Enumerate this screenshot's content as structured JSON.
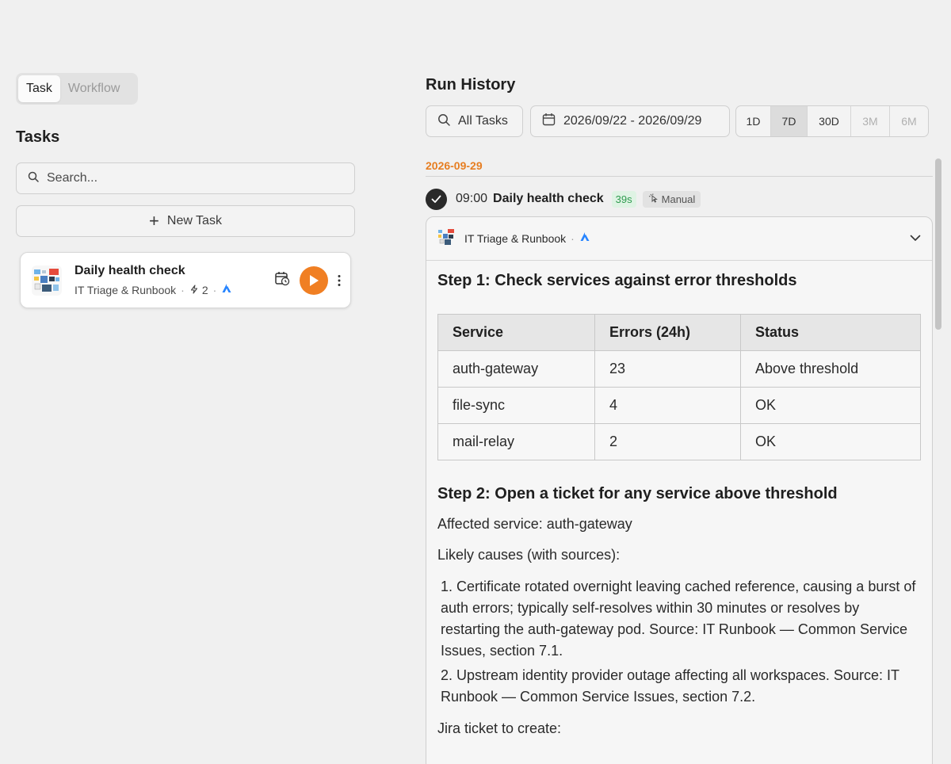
{
  "mode_toggle": {
    "task_label": "Task",
    "workflow_label": "Workflow"
  },
  "tasks_panel": {
    "title": "Tasks",
    "search_placeholder": "Search...",
    "new_task_label": "New Task",
    "items": [
      {
        "name": "Daily health check",
        "agent": "IT Triage & Runbook",
        "steps": "2"
      }
    ]
  },
  "run_history": {
    "title": "Run History",
    "filter_label": "All Tasks",
    "date_range": "2026/09/22 - 2026/09/29",
    "ranges": [
      {
        "label": "1D",
        "state": "normal"
      },
      {
        "label": "7D",
        "state": "active"
      },
      {
        "label": "30D",
        "state": "normal"
      },
      {
        "label": "3M",
        "state": "disabled"
      },
      {
        "label": "6M",
        "state": "disabled"
      }
    ],
    "date_group": "2026-09-29",
    "run": {
      "time": "09:00",
      "name": "Daily health check",
      "duration": "39s",
      "trigger": "Manual",
      "agent": "IT Triage & Runbook"
    },
    "step1": {
      "heading": "Step 1: Check services against error thresholds",
      "columns": [
        "Service",
        "Errors (24h)",
        "Status"
      ],
      "rows": [
        [
          "auth-gateway",
          "23",
          "Above threshold"
        ],
        [
          "file-sync",
          "4",
          "OK"
        ],
        [
          "mail-relay",
          "2",
          "OK"
        ]
      ]
    },
    "step2": {
      "heading": "Step 2: Open a ticket for any service above threshold",
      "affected": "Affected service: auth-gateway",
      "causes_title": "Likely causes (with sources):",
      "causes": [
        "1. Certificate rotated overnight leaving cached reference, causing a burst of auth errors; typically self-resolves within 30 minutes or resolves by restarting the auth-gateway pod. Source: IT Runbook — Common Service Issues, section 7.1.",
        "2. Upstream identity provider outage affecting all workspaces. Source: IT Runbook — Common Service Issues, section 7.2."
      ],
      "jira_title": "Jira ticket to create:"
    }
  },
  "colors": {
    "accent": "#f07f23",
    "date": "#e67e22",
    "success": "#2e9b4e",
    "jira": "#2684ff"
  }
}
